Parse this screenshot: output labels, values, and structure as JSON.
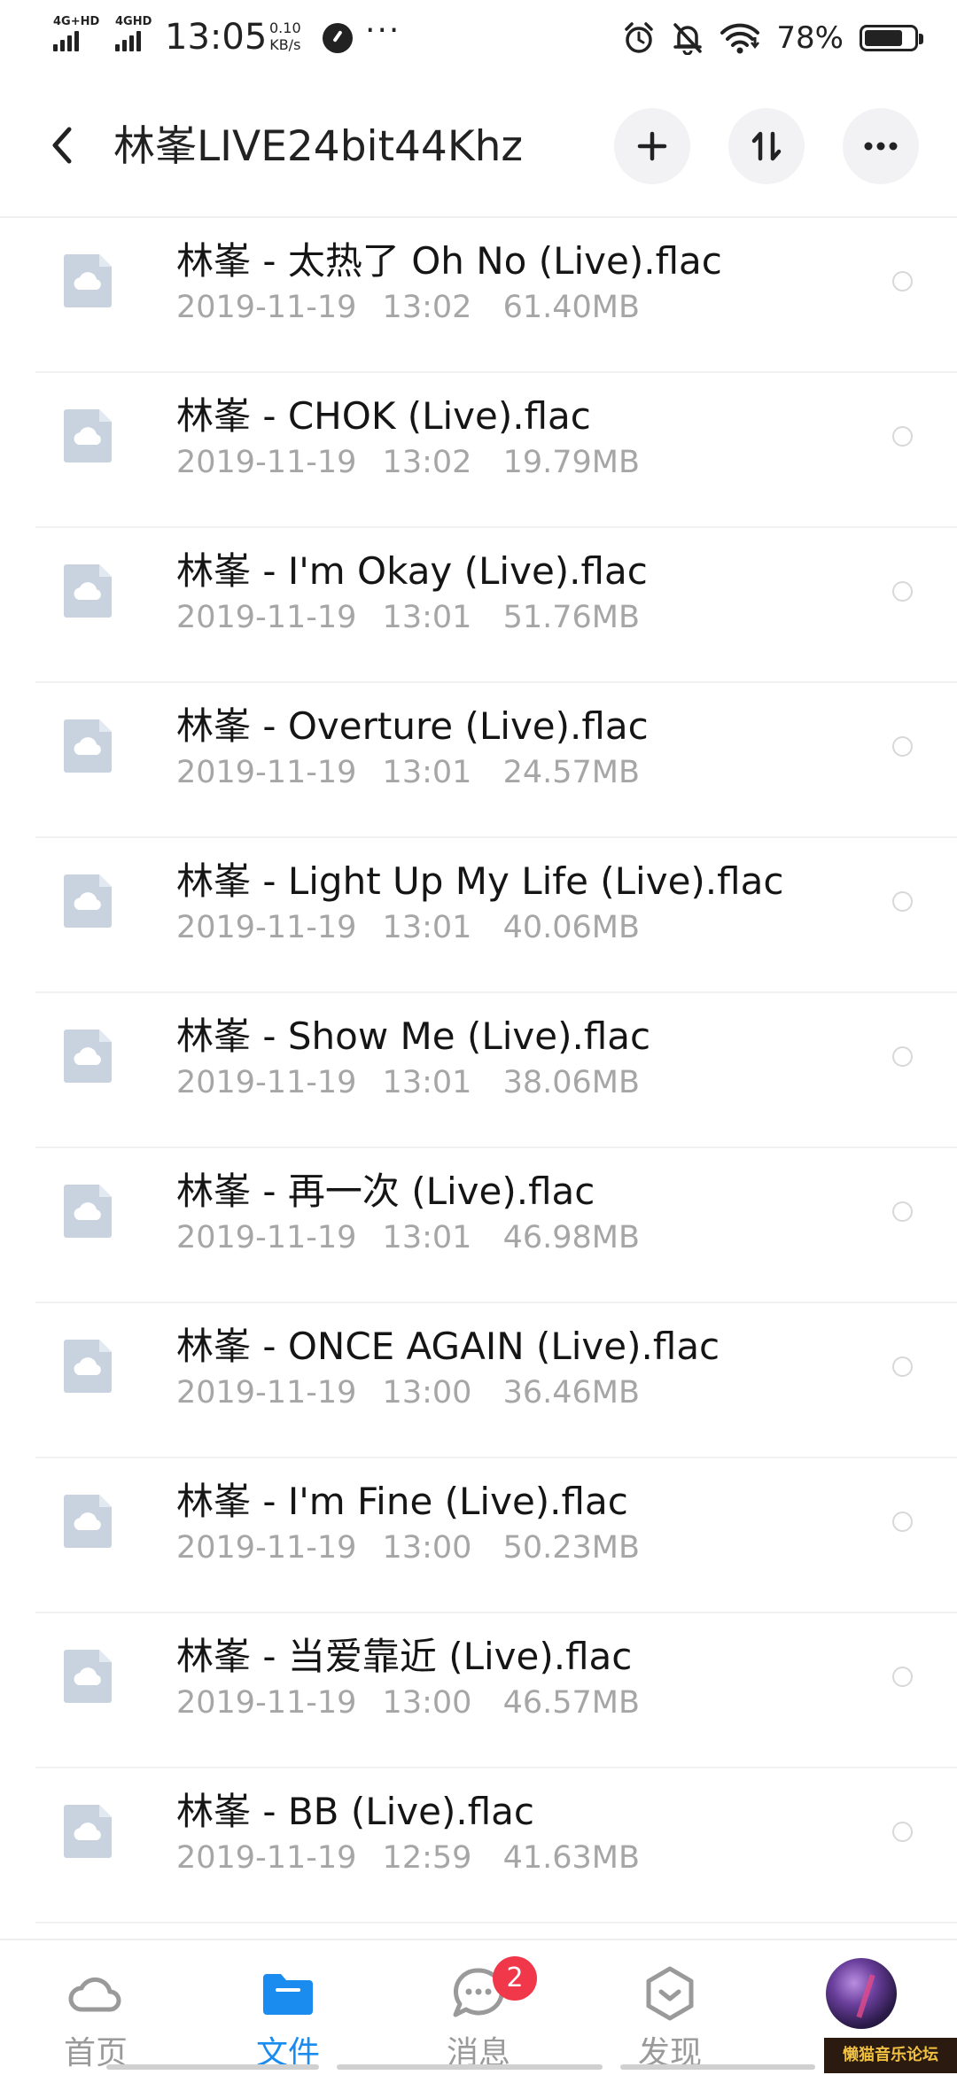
{
  "status_bar": {
    "net1": "4G+HD",
    "net2": "4GHD",
    "time": "13:05",
    "speed_value": "0.10",
    "speed_unit": "KB/s",
    "more": "···",
    "battery_pct": "78%",
    "battery_level": 0.78
  },
  "header": {
    "title": "林峯LIVE24bit44Khz"
  },
  "files": [
    {
      "name": "林峯 - 太热了 Oh No (Live).flac",
      "date": "2019-11-19",
      "time": "13:02",
      "size": "61.40MB"
    },
    {
      "name": "林峯 - CHOK (Live).flac",
      "date": "2019-11-19",
      "time": "13:02",
      "size": "19.79MB"
    },
    {
      "name": "林峯 - I'm Okay (Live).flac",
      "date": "2019-11-19",
      "time": "13:01",
      "size": "51.76MB"
    },
    {
      "name": "林峯 - Overture (Live).flac",
      "date": "2019-11-19",
      "time": "13:01",
      "size": "24.57MB"
    },
    {
      "name": "林峯 - Light Up My Life (Live).flac",
      "date": "2019-11-19",
      "time": "13:01",
      "size": "40.06MB"
    },
    {
      "name": "林峯 - Show Me (Live).flac",
      "date": "2019-11-19",
      "time": "13:01",
      "size": "38.06MB"
    },
    {
      "name": "林峯 - 再一次 (Live).flac",
      "date": "2019-11-19",
      "time": "13:01",
      "size": "46.98MB"
    },
    {
      "name": "林峯 - ONCE AGAIN (Live).flac",
      "date": "2019-11-19",
      "time": "13:00",
      "size": "36.46MB"
    },
    {
      "name": "林峯 - I'm Fine (Live).flac",
      "date": "2019-11-19",
      "time": "13:00",
      "size": "50.23MB"
    },
    {
      "name": "林峯 - 当爱靠近 (Live).flac",
      "date": "2019-11-19",
      "time": "13:00",
      "size": "46.57MB"
    },
    {
      "name": "林峯 - BB (Live).flac",
      "date": "2019-11-19",
      "time": "12:59",
      "size": "41.63MB"
    }
  ],
  "nav": {
    "home": "首页",
    "files": "文件",
    "messages": "消息",
    "messages_badge": "2",
    "discover": "发现",
    "active_color": "#1a8cf0",
    "inactive_color": "#9a9a9a"
  },
  "watermark": "懒猫音乐论坛"
}
